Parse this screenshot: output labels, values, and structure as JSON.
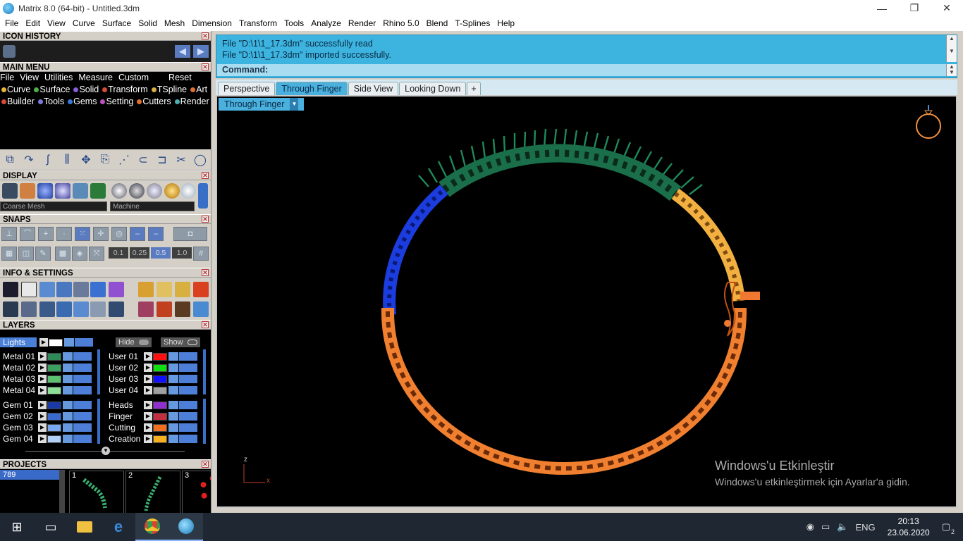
{
  "window": {
    "title": "Matrix 8.0 (64-bit) - Untitled.3dm",
    "minimize": "—",
    "restore": "❐",
    "close": "✕"
  },
  "menubar": [
    "File",
    "Edit",
    "View",
    "Curve",
    "Surface",
    "Solid",
    "Mesh",
    "Dimension",
    "Transform",
    "Tools",
    "Analyze",
    "Render",
    "Rhino 5.0",
    "Blend",
    "T-Splines",
    "Help"
  ],
  "left_panel": {
    "icon_history": {
      "header": "ICON HISTORY",
      "prev": "◀",
      "next": "▶"
    },
    "main_menu": {
      "header": "MAIN MENU",
      "tabs": [
        "File",
        "View",
        "Utilities",
        "Measure",
        "Custom"
      ],
      "reset": "Reset",
      "row2": [
        {
          "label": "Curve",
          "color": "#e6b53a"
        },
        {
          "label": "Surface",
          "color": "#4cb04c"
        },
        {
          "label": "Solid",
          "color": "#8a5cd6"
        },
        {
          "label": "Transform",
          "color": "#d84a3a"
        },
        {
          "label": "TSpline",
          "color": "#d8b040"
        },
        {
          "label": "Art",
          "color": "#e07030"
        }
      ],
      "row3": [
        {
          "label": "Builder",
          "color": "#d84a3a"
        },
        {
          "label": "Tools",
          "color": "#7a7ad8"
        },
        {
          "label": "Gems",
          "color": "#3a78d8"
        },
        {
          "label": "Setting",
          "color": "#c050c0"
        },
        {
          "label": "Cutters",
          "color": "#e07030"
        },
        {
          "label": "Render",
          "color": "#4cb0b0"
        }
      ]
    },
    "display": {
      "header": "DISPLAY",
      "mesh_select": "Coarse Mesh",
      "material_select": "Machine"
    },
    "snaps": {
      "header": "SNAPS",
      "values": [
        "0.1",
        "0.25",
        "0.5",
        "1.0"
      ]
    },
    "info": {
      "header": "INFO & SETTINGS"
    },
    "layers": {
      "header": "LAYERS",
      "lights": "Lights",
      "hide": "Hide",
      "show": "Show",
      "left_group1": [
        {
          "name": "Metal 01",
          "color": "#2e8b57"
        },
        {
          "name": "Metal 02",
          "color": "#3aa060"
        },
        {
          "name": "Metal 03",
          "color": "#5cc070"
        },
        {
          "name": "Metal 04",
          "color": "#8ee098"
        }
      ],
      "right_group1": [
        {
          "name": "User 01",
          "color": "#ff1010"
        },
        {
          "name": "User 02",
          "color": "#10e010"
        },
        {
          "name": "User 03",
          "color": "#1010ff"
        },
        {
          "name": "User 04",
          "color": "#a0a0a0"
        }
      ],
      "left_group2": [
        {
          "name": "Gem 01",
          "color": "#1a3aa8"
        },
        {
          "name": "Gem 02",
          "color": "#3a6ad0"
        },
        {
          "name": "Gem 03",
          "color": "#7aa8f0"
        },
        {
          "name": "Gem 04",
          "color": "#b0d0f8"
        }
      ],
      "right_group2": [
        {
          "name": "Heads",
          "color": "#9030d0"
        },
        {
          "name": "Finger",
          "color": "#c03040"
        },
        {
          "name": "Cutting",
          "color": "#f07020"
        },
        {
          "name": "Creation",
          "color": "#f8b020"
        }
      ]
    },
    "projects": {
      "header": "PROJECTS",
      "item": "789",
      "thumbs": [
        "1",
        "2",
        "3"
      ]
    }
  },
  "command": {
    "log": [
      "File \"D:\\1\\1_17.3dm\" successfully read",
      "File \"D:\\1\\1_17.3dm\" imported successfully."
    ],
    "prompt": "Command:"
  },
  "view_tabs": [
    "Perspective",
    "Through Finger",
    "Side View",
    "Looking Down"
  ],
  "active_tab": "Through Finger",
  "viewport": {
    "label": "Through Finger",
    "axis_z": "z",
    "axis_x": "x",
    "watermark_title": "Windows'u Etkinleştir",
    "watermark_sub": "Windows'u etkinleştirmek için Ayarlar'a gidin."
  },
  "taskbar": {
    "lang": "ENG",
    "time": "20:13",
    "date": "23.06.2020",
    "notifications": "2"
  }
}
